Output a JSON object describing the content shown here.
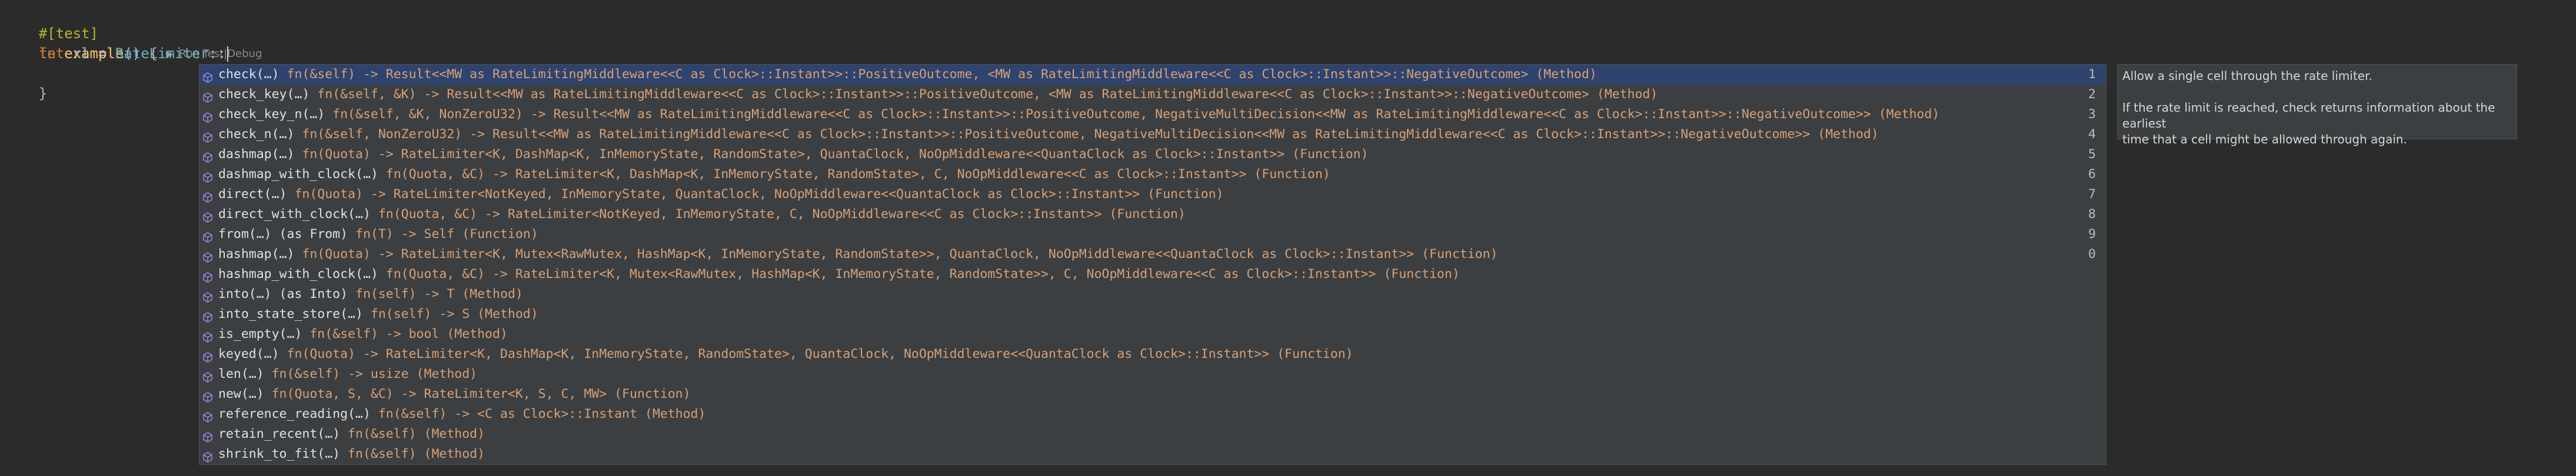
{
  "editor": {
    "attribute": "#[test]",
    "fn_keyword": "fn",
    "fn_name": "example",
    "fn_signature_rest": "() {",
    "run_test_label": "Run Test",
    "separator": "|",
    "debug_label": "Debug",
    "let_keyword": "let",
    "var_assign": " rl = ",
    "type_name": "RateLimiter",
    "path_sep": "::",
    "closing_brace": "}"
  },
  "completion": {
    "items": [
      {
        "name": "check(…)",
        "detail": " fn(&self) -> Result<<MW as RateLimitingMiddleware<<C as Clock>::Instant>>::PositiveOutcome, <MW as RateLimitingMiddleware<<C as Clock>::Instant>>::NegativeOutcome> (Method)",
        "num": "1"
      },
      {
        "name": "check_key(…)",
        "detail": " fn(&self, &K) -> Result<<MW as RateLimitingMiddleware<<C as Clock>::Instant>>::PositiveOutcome, <MW as RateLimitingMiddleware<<C as Clock>::Instant>>::NegativeOutcome> (Method)",
        "num": "2"
      },
      {
        "name": "check_key_n(…)",
        "detail": " fn(&self, &K, NonZeroU32) -> Result<<MW as RateLimitingMiddleware<<C as Clock>::Instant>>::PositiveOutcome, NegativeMultiDecision<<MW as RateLimitingMiddleware<<C as Clock>::Instant>>::NegativeOutcome>> (Method)",
        "num": "3"
      },
      {
        "name": "check_n(…)",
        "detail": " fn(&self, NonZeroU32) -> Result<<MW as RateLimitingMiddleware<<C as Clock>::Instant>>::PositiveOutcome, NegativeMultiDecision<<MW as RateLimitingMiddleware<<C as Clock>::Instant>>::NegativeOutcome>> (Method)",
        "num": "4"
      },
      {
        "name": "dashmap(…)",
        "detail": " fn(Quota) -> RateLimiter<K, DashMap<K, InMemoryState, RandomState>, QuantaClock, NoOpMiddleware<<QuantaClock as Clock>::Instant>> (Function)",
        "num": "5"
      },
      {
        "name": "dashmap_with_clock(…)",
        "detail": " fn(Quota, &C) -> RateLimiter<K, DashMap<K, InMemoryState, RandomState>, C, NoOpMiddleware<<C as Clock>::Instant>> (Function)",
        "num": "6"
      },
      {
        "name": "direct(…)",
        "detail": " fn(Quota) -> RateLimiter<NotKeyed, InMemoryState, QuantaClock, NoOpMiddleware<<QuantaClock as Clock>::Instant>> (Function)",
        "num": "7"
      },
      {
        "name": "direct_with_clock(…)",
        "detail": " fn(Quota, &C) -> RateLimiter<NotKeyed, InMemoryState, C, NoOpMiddleware<<C as Clock>::Instant>> (Function)",
        "num": "8"
      },
      {
        "name": "from(…) (as From)",
        "detail": " fn(T) -> Self (Function)",
        "num": "9"
      },
      {
        "name": "hashmap(…)",
        "detail": " fn(Quota) -> RateLimiter<K, Mutex<RawMutex, HashMap<K, InMemoryState, RandomState>>, QuantaClock, NoOpMiddleware<<QuantaClock as Clock>::Instant>> (Function)",
        "num": "0"
      },
      {
        "name": "hashmap_with_clock(…)",
        "detail": " fn(Quota, &C) -> RateLimiter<K, Mutex<RawMutex, HashMap<K, InMemoryState, RandomState>>, C, NoOpMiddleware<<C as Clock>::Instant>> (Function)",
        "num": ""
      },
      {
        "name": "into(…) (as Into)",
        "detail": " fn(self) -> T (Method)",
        "num": ""
      },
      {
        "name": "into_state_store(…)",
        "detail": " fn(self) -> S (Method)",
        "num": ""
      },
      {
        "name": "is_empty(…)",
        "detail": " fn(&self) -> bool (Method)",
        "num": ""
      },
      {
        "name": "keyed(…)",
        "detail": " fn(Quota) -> RateLimiter<K, DashMap<K, InMemoryState, RandomState>, QuantaClock, NoOpMiddleware<<QuantaClock as Clock>::Instant>> (Function)",
        "num": ""
      },
      {
        "name": "len(…)",
        "detail": " fn(&self) -> usize (Method)",
        "num": ""
      },
      {
        "name": "new(…)",
        "detail": " fn(Quota, S, &C) -> RateLimiter<K, S, C, MW> (Function)",
        "num": ""
      },
      {
        "name": "reference_reading(…)",
        "detail": " fn(&self) -> <C as Clock>::Instant (Method)",
        "num": ""
      },
      {
        "name": "retain_recent(…)",
        "detail": " fn(&self) (Method)",
        "num": ""
      },
      {
        "name": "shrink_to_fit(…)",
        "detail": " fn(&self) (Method)",
        "num": ""
      }
    ],
    "icon_color": "#9f7fd0"
  },
  "documentation": {
    "line1": "Allow a single cell through the rate limiter.",
    "line2": "If the rate limit is reached, check returns information about the earliest",
    "line3": "time that a cell might be allowed through again."
  }
}
